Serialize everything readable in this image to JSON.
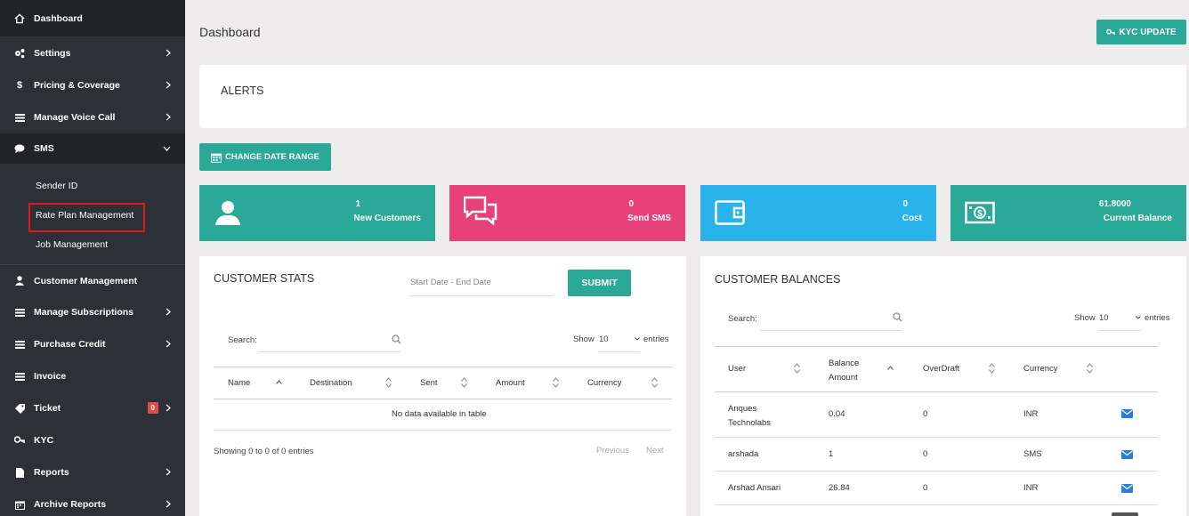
{
  "sidebar": {
    "items": [
      {
        "label": "Dashboard",
        "icon": "home-icon"
      },
      {
        "label": "Settings",
        "icon": "cogs-icon"
      },
      {
        "label": "Pricing & Coverage",
        "icon": "dollar-icon"
      },
      {
        "label": "Manage Voice Call",
        "icon": "list-icon"
      },
      {
        "label": "SMS",
        "icon": "comment-icon"
      },
      {
        "label": "Customer Management",
        "icon": "user-icon"
      },
      {
        "label": "Manage Subscriptions",
        "icon": "list-icon"
      },
      {
        "label": "Purchase Credit",
        "icon": "list-icon"
      },
      {
        "label": "Invoice",
        "icon": "list-icon"
      },
      {
        "label": "Ticket",
        "icon": "tag-icon",
        "badge": "0"
      },
      {
        "label": "KYC",
        "icon": "key-icon"
      },
      {
        "label": "Reports",
        "icon": "file-icon"
      },
      {
        "label": "Archive Reports",
        "icon": "calendar-icon"
      }
    ],
    "sms_submenu": [
      "Sender ID",
      "Rate Plan Management",
      "Job Management"
    ]
  },
  "header": {
    "title": "Dashboard",
    "kyc_button": "KYC UPDATE"
  },
  "alerts": {
    "title": "ALERTS"
  },
  "date_range_button": "CHANGE DATE RANGE",
  "stats": [
    {
      "value": "1",
      "label": "New Customers",
      "color": "#2aa898",
      "icon": "user-icon"
    },
    {
      "value": "0",
      "label": "Send SMS",
      "color": "#e8417a",
      "icon": "comments-icon"
    },
    {
      "value": "0",
      "label": "Cost",
      "color": "#2ab3eb",
      "icon": "wallet-icon"
    },
    {
      "value": "61.8000",
      "label": "Current Balance",
      "color": "#2aa898",
      "icon": "money-icon"
    }
  ],
  "customer_stats": {
    "title": "CUSTOMER STATS",
    "date_placeholder": "Start Date - End Date",
    "submit": "SUBMIT",
    "search_label": "Search:",
    "show_label": "Show",
    "show_value": "10",
    "entries_label": "entries",
    "columns": [
      "Name",
      "Destination",
      "Sent",
      "Amount",
      "Currency"
    ],
    "empty": "No data available in table",
    "info": "Showing 0 to 0 of 0 entries",
    "prev": "Previous",
    "next": "Next"
  },
  "customer_balances": {
    "title": "CUSTOMER BALANCES",
    "search_label": "Search:",
    "show_label": "Show",
    "show_value": "10",
    "entries_label": "entries",
    "columns": [
      "User",
      "Balance Amount",
      "OverDraft",
      "Currency"
    ],
    "rows": [
      {
        "user": "Anques Technolabs",
        "balance": "0.04",
        "overdraft": "0",
        "currency": "INR"
      },
      {
        "user": "arshada",
        "balance": "1",
        "overdraft": "0",
        "currency": "SMS"
      },
      {
        "user": "Arshad Ansari",
        "balance": "26.84",
        "overdraft": "0",
        "currency": "INR"
      }
    ]
  },
  "colors": {
    "accent": "#2aa898",
    "sidebar": "#2b3137",
    "mail": "#2b7fd1"
  }
}
